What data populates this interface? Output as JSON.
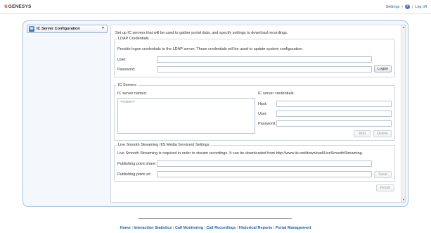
{
  "header": {
    "brand": "GENESYS",
    "settings_label": "Settings",
    "separator": "|",
    "help_glyph": "?",
    "logoff_label": "Log off"
  },
  "selector": {
    "selected": "IC Server Configuration",
    "icon": "server-config-icon"
  },
  "intro": "Set up IC servers that will be used to gather portal data, and specify settings to download recordings.",
  "ldap": {
    "legend": "LDAP Credentials",
    "description": "Provide logon credentials to the LDAP server. These credentials will be used to update system configuration.",
    "user_label": "User:",
    "user_value": "",
    "password_label": "Password:",
    "password_value": "",
    "logon_button": "Logon"
  },
  "ic_servers": {
    "legend": "IC Servers",
    "names_label": "IC server names:",
    "names_placeholder": "<<new>>",
    "credentials_label": "IC server credentials:",
    "host_label": "Host:",
    "user_label": "User:",
    "password_label": "Password:",
    "add_button": "Add",
    "delete_button": "Delete"
  },
  "live_smooth": {
    "legend": "Live Smooth Streaming (IIS Media Services) Settings",
    "description": "Live Smooth Streaming is required in order to stream recordings. It can be downloaded from http://www.iis.net/download/LiveSmoothStreaming.",
    "share_label": "Publishing point share:",
    "url_label": "Publishing point url:",
    "save_button": "Save"
  },
  "finish_button": "Finish",
  "footer": {
    "links": [
      "Home",
      "Interaction Statistics",
      "Call Monitoring",
      "Call Recordings",
      "Historical Reports",
      "Portal Management"
    ],
    "separator": "|"
  },
  "colors": {
    "brand_accent": "#e8501e",
    "link": "#1a5fa6",
    "frame_border": "#a7c1de"
  }
}
